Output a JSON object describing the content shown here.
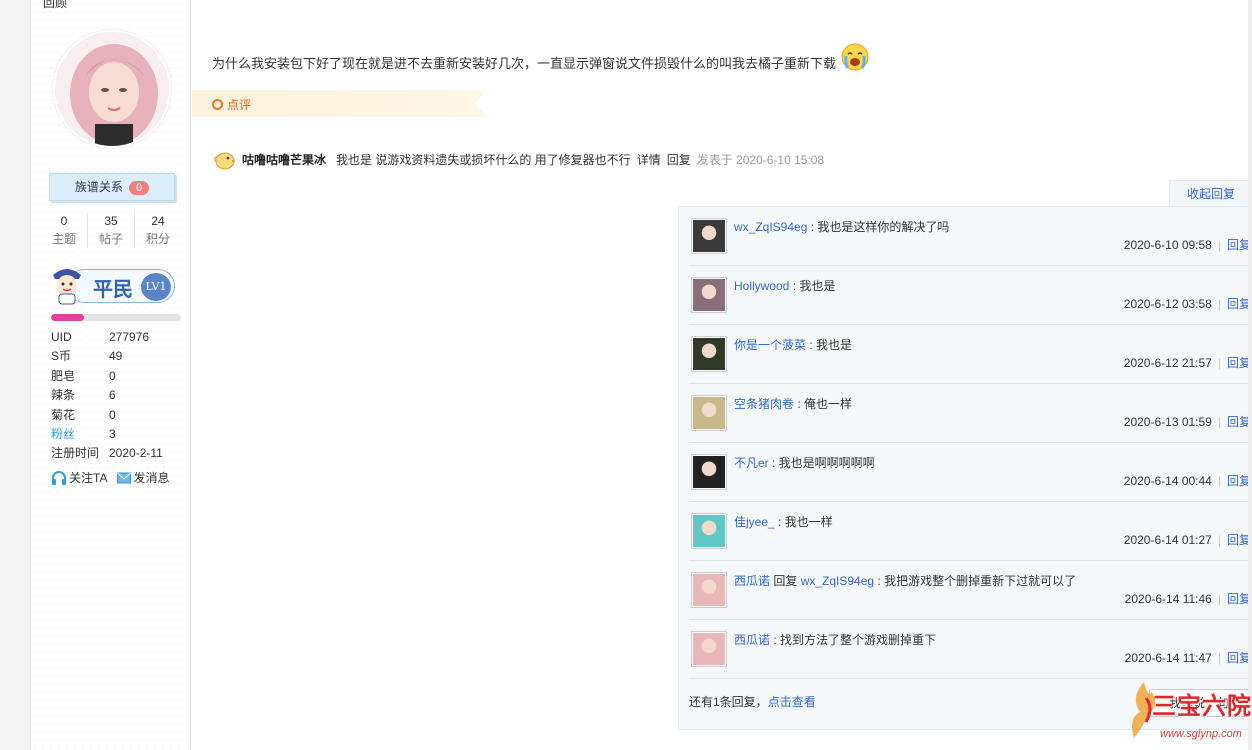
{
  "sidebar": {
    "top_label": "回顾",
    "clan_label": "族谱关系",
    "clan_count": "0",
    "stats": [
      {
        "value": "0",
        "label": "主题"
      },
      {
        "value": "35",
        "label": "帖子"
      },
      {
        "value": "24",
        "label": "积分"
      }
    ],
    "rank_title": "平民",
    "rank_level": "LV1",
    "progress": 0.25,
    "info": [
      {
        "key": "UID",
        "value": "277976"
      },
      {
        "key": "S币",
        "value": "49"
      },
      {
        "key": "肥皂",
        "value": "0"
      },
      {
        "key": "辣条",
        "value": "6"
      },
      {
        "key": "菊花",
        "value": "0"
      },
      {
        "key": "粉丝",
        "value": "3"
      },
      {
        "key": "注册时间",
        "value": "2020-2-11"
      }
    ],
    "follow_label": "关注TA",
    "message_label": "发消息"
  },
  "main": {
    "question": "为什么我安装包下好了现在就是进不去重新安装好几次，一直显示弹窗说文件损毁什么的叫我去橘子重新下载",
    "comment_tab": "点评",
    "post": {
      "author": "咕噜咕噜芒果冰",
      "message": "我也是 说游戏资料遗失或损坏什么的 用了修复器也不行",
      "detail": "详情",
      "reply": "回复",
      "time": "发表于 2020-6-10 15:08"
    },
    "collapse_label": "收起回复",
    "replies": [
      {
        "user": "wx_ZqIS94eg",
        "reply_to": "",
        "text": " : 我也是这样你的解决了吗",
        "time": "2020-6-10 09:58",
        "action": "回复",
        "avatar_color": "#3a3a3a"
      },
      {
        "user": "Hollywood",
        "reply_to": "",
        "text": " : 我也是",
        "time": "2020-6-12 03:58",
        "action": "回复",
        "avatar_color": "#8a6d7a"
      },
      {
        "user": "你是一个菠菜",
        "reply_to": "",
        "text": " : 我也是",
        "time": "2020-6-12 21:57",
        "action": "回复",
        "avatar_color": "#2f3a2a"
      },
      {
        "user": "空条猪肉卷",
        "reply_to": "",
        "text": " : 俺也一样",
        "time": "2020-6-13 01:59",
        "action": "回复",
        "avatar_color": "#c9b98a"
      },
      {
        "user": "不凡er",
        "reply_to": "",
        "text": " : 我也是啊啊啊啊啊",
        "time": "2020-6-14 00:44",
        "action": "回复",
        "avatar_color": "#222222"
      },
      {
        "user": "佳jyee_",
        "reply_to": "",
        "text": " : 我也一样",
        "time": "2020-6-14 01:27",
        "action": "回复",
        "avatar_color": "#5fc7c4"
      },
      {
        "user": "西瓜诺",
        "reply_to": "wx_ZqIS94eg",
        "text": " : 我把游戏整个删掉重新下过就可以了",
        "time": "2020-6-14 11:46",
        "action": "回复",
        "avatar_color": "#e9b7b7"
      },
      {
        "user": "西瓜诺",
        "reply_to": "",
        "text": " : 找到方法了整个游戏删掉重下",
        "time": "2020-6-14 11:47",
        "action": "回复",
        "avatar_color": "#e9b7b7"
      }
    ],
    "reply_word": " 回复 ",
    "more_text": "还有1条回复，",
    "more_link": "点击查看",
    "say_button": "我也说一句"
  },
  "watermark": {
    "logo": "三宝六院",
    "url": "www.sglynp.com"
  }
}
